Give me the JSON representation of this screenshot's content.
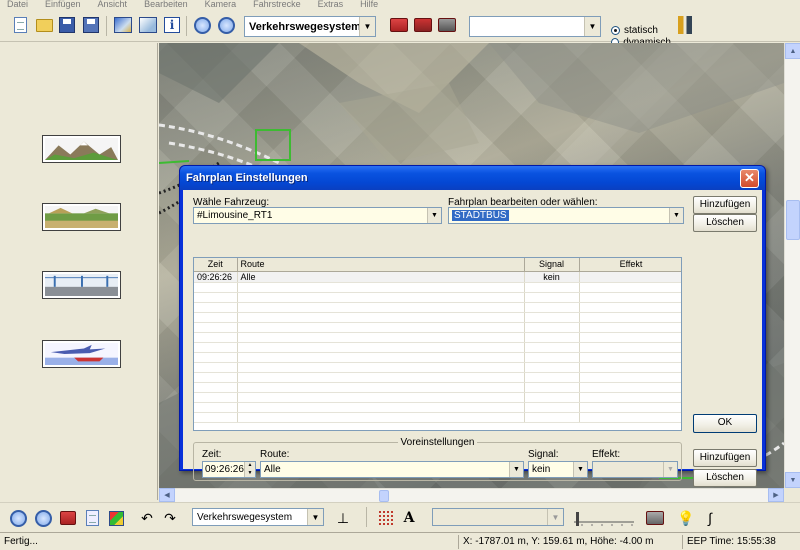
{
  "menu": [
    "Datei",
    "Einfügen",
    "Ansicht",
    "Bearbeiten",
    "Kamera",
    "Fahrstrecke",
    "Extras",
    "Hilfe"
  ],
  "toolbar": {
    "track_system_combo": "Verkehrswegesystem",
    "search_combo": "",
    "mode_static": "statisch",
    "mode_dynamic": "dynamisch",
    "mode_selected": "statisch"
  },
  "bottom_toolbar": {
    "track_system_combo": "Verkehrswegesystem",
    "object_combo": ""
  },
  "status": {
    "left": "Fertig...",
    "coords": "X: -1787.01 m, Y: 159.61 m, Höhe: -4.00 m",
    "time": "EEP Time: 15:55:38"
  },
  "dialog": {
    "title": "Fahrplan Einstellungen",
    "vehicle_label": "Wähle Fahrzeug:",
    "vehicle_value": "#Limousine_RT1",
    "schedule_label": "Fahrplan bearbeiten oder wählen:",
    "schedule_value": "STADTBUS",
    "add_button_top": "Hinzufügen",
    "delete_button_top": "Löschen",
    "ok_button": "OK",
    "add_button_bottom": "Hinzufügen",
    "delete_button_bottom": "Löschen",
    "table": {
      "headers": [
        "Zeit",
        "Route",
        "Signal",
        "Effekt"
      ],
      "rows": [
        {
          "zeit": "09:26:26",
          "route": "Alle",
          "signal": "kein",
          "effekt": ""
        }
      ]
    },
    "preset": {
      "title": "Voreinstellungen",
      "time_label": "Zeit:",
      "time_value": "09:26:26",
      "route_label": "Route:",
      "route_value": "Alle",
      "signal_label": "Signal:",
      "signal_value": "kein",
      "effect_label": "Effekt:",
      "effect_value": ""
    }
  },
  "colors": {
    "dialog_title_bar": "#0a53e0",
    "input_background": "#fffde7",
    "selection": "#316ac5",
    "terrain": "#9b9c8e"
  }
}
